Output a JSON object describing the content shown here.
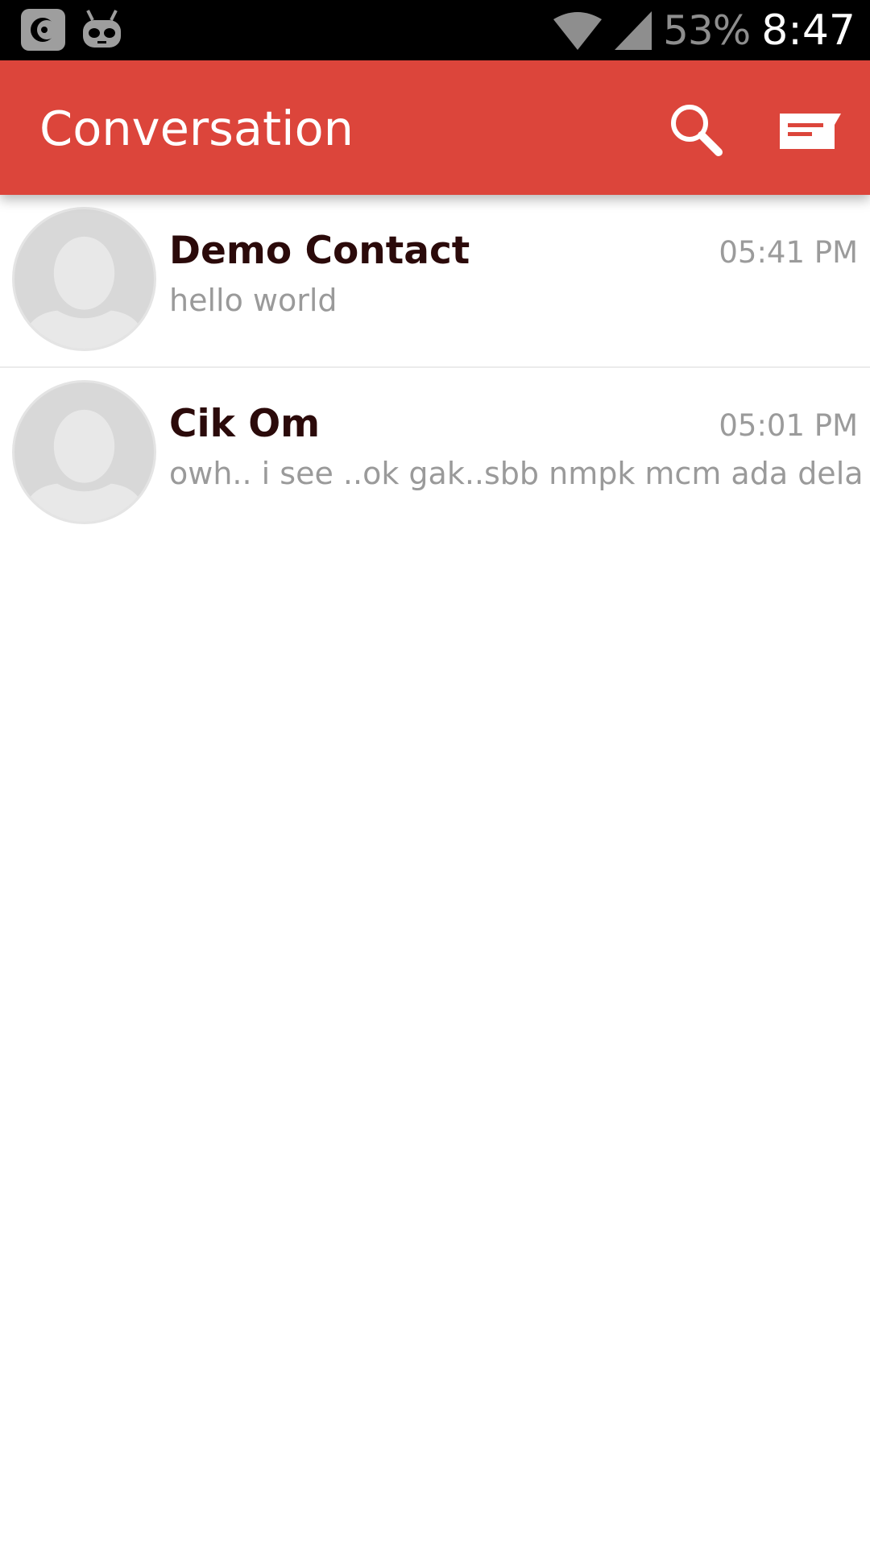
{
  "status_bar": {
    "icons_left": [
      "cyanogen-icon",
      "android-robot-icon"
    ],
    "icons_right": [
      "wifi-icon",
      "signal-icon"
    ],
    "battery": "53%",
    "time": "8:47"
  },
  "app_bar": {
    "title": "Conversation",
    "actions": [
      "search-icon",
      "compose-message-icon"
    ],
    "color": "#dc453b"
  },
  "conversations": [
    {
      "name": "Demo Contact",
      "time": "05:41 PM",
      "preview": "hello world"
    },
    {
      "name": "Cik Om",
      "time": "05:01 PM",
      "preview": "owh.. i see ..ok gak..sbb nmpk mcm ada delay"
    }
  ]
}
